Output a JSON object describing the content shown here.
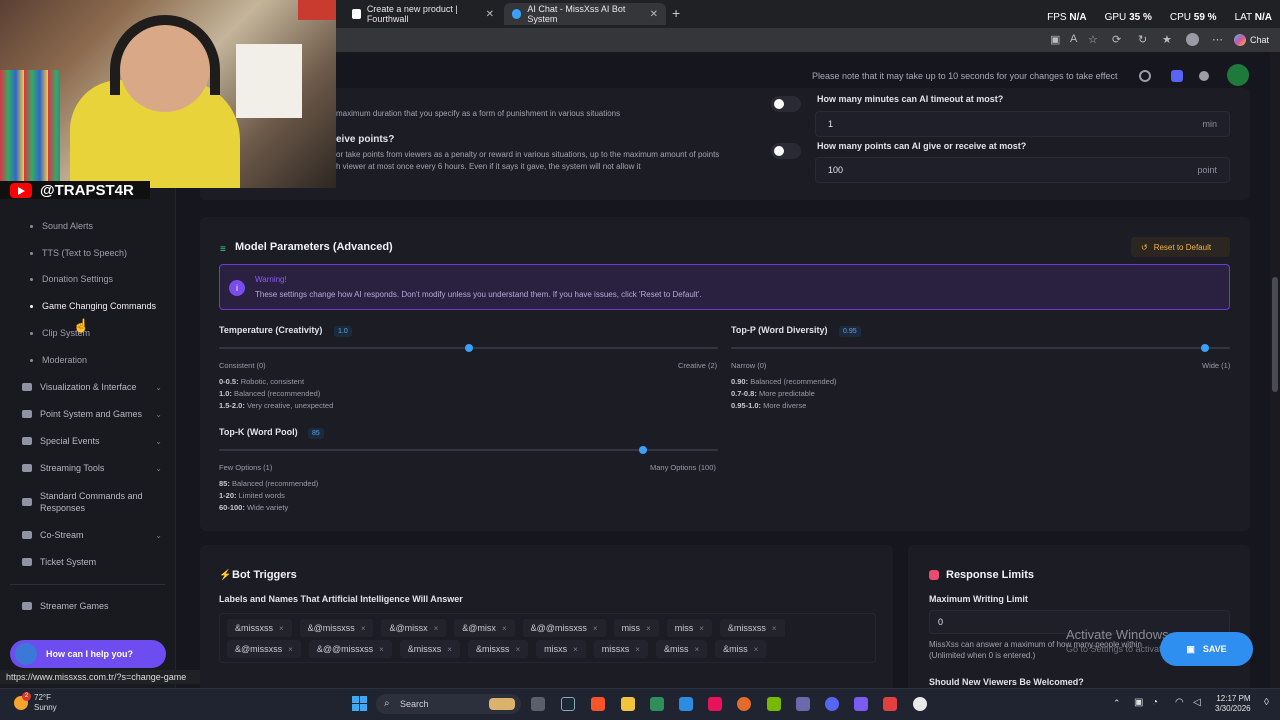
{
  "browser": {
    "tabs": [
      {
        "title": "Create a new product | Fourthwall"
      },
      {
        "title": "AI Chat - MissXss AI Bot System"
      }
    ],
    "stats": {
      "fps_label": "FPS",
      "fps_value": "N/A",
      "gpu_label": "GPU",
      "gpu_value": "35 %",
      "cpu_label": "CPU",
      "cpu_value": "59 %",
      "lat_label": "LAT",
      "lat_value": "N/A"
    },
    "chat_label": "Chat",
    "status_url": "https://www.missxss.com.tr/?s=change-game"
  },
  "overlay": {
    "handle": "@TRAPST4R"
  },
  "header": {
    "note": "Please note that it may take up to 10 seconds for your changes to take effect"
  },
  "sidebar": {
    "sub_items": [
      {
        "label": "Sound Alerts"
      },
      {
        "label": "TTS (Text to Speech)"
      },
      {
        "label": "Donation Settings"
      },
      {
        "label": "Game Changing Commands"
      },
      {
        "label": "Clip System"
      },
      {
        "label": "Moderation"
      }
    ],
    "main_items": [
      {
        "label": "Visualization & Interface"
      },
      {
        "label": "Point System and Games"
      },
      {
        "label": "Special Events"
      },
      {
        "label": "Streaming Tools"
      },
      {
        "label": "Standard Commands and Responses"
      },
      {
        "label": "Co-Stream"
      },
      {
        "label": "Ticket System"
      }
    ],
    "extra_item": "Streamer Games",
    "help": "How can I help you?"
  },
  "top_card": {
    "timeout_desc": "maximum duration that you specify as a form of punishment in various situations",
    "timeout_question": "How many minutes can AI timeout at most?",
    "timeout_value": "1",
    "timeout_unit": "min",
    "points_title": "eive points?",
    "points_desc1": "or take points from viewers as a penalty or reward in various situations, up to the maximum amount of points",
    "points_desc2": "h viewer at most once every 6 hours. Even if it says it gave, the system will not allow it",
    "points_question": "How many points can AI give or receive at most?",
    "points_value": "100",
    "points_unit": "point"
  },
  "model": {
    "title": "Model Parameters (Advanced)",
    "reset": "Reset to Default",
    "warning_title": "Warning!",
    "warning_text": "These settings change how AI responds. Don't modify unless you understand them. If you have issues, click 'Reset to Default'.",
    "temperature": {
      "label": "Temperature (Creativity)",
      "value": "1.0",
      "fraction": 0.5,
      "min_label": "Consistent (0)",
      "max_label": "Creative (2)",
      "legend": [
        {
          "k": "0-0.5:",
          "v": "Robotic, consistent"
        },
        {
          "k": "1.0:",
          "v": "Balanced (recommended)"
        },
        {
          "k": "1.5-2.0:",
          "v": "Very creative, unexpected"
        }
      ]
    },
    "top_p": {
      "label": "Top-P (Word Diversity)",
      "value": "0.95",
      "fraction": 0.95,
      "min_label": "Narrow (0)",
      "max_label": "Wide (1)",
      "legend": [
        {
          "k": "0.90:",
          "v": "Balanced (recommended)"
        },
        {
          "k": "0.7-0.8:",
          "v": "More predictable"
        },
        {
          "k": "0.95-1.0:",
          "v": "More diverse"
        }
      ]
    },
    "top_k": {
      "label": "Top-K (Word Pool)",
      "value": "85",
      "fraction": 0.85,
      "min_label": "Few Options (1)",
      "max_label": "Many Options (100)",
      "legend": [
        {
          "k": "85:",
          "v": "Balanced (recommended)"
        },
        {
          "k": "1-20:",
          "v": "Limited words"
        },
        {
          "k": "60-100:",
          "v": "Wide variety"
        }
      ]
    }
  },
  "triggers": {
    "title": "Bot Triggers",
    "subtitle": "Labels and Names That Artificial Intelligence Will Answer",
    "row1": [
      "&missxss",
      "&@missxss",
      "&@missx",
      "&@misx",
      "&@@missxss",
      "miss",
      "miss",
      "&missxss"
    ],
    "row2": [
      "&@missxss",
      "&@@missxss",
      "&missxs",
      "&misxss",
      "misxs",
      "missxs",
      "&miss",
      "&miss"
    ]
  },
  "limits": {
    "title": "Response Limits",
    "max_label": "Maximum Writing Limit",
    "max_value": "0",
    "max_desc1": "MissXss can answer a maximum of how many people within",
    "max_desc2": "(Unlimited when 0 is entered.)",
    "welcome": "Should New Viewers Be Welcomed?"
  },
  "save": "SAVE",
  "windows": {
    "activate": "Activate Windows",
    "activate_sub": "Go to Settings to activate Windows.",
    "search": "Search",
    "temp": "72°F",
    "weather": "Sunny",
    "weather_badge": "2",
    "time": "12:17 PM",
    "date": "3/30/2026"
  }
}
